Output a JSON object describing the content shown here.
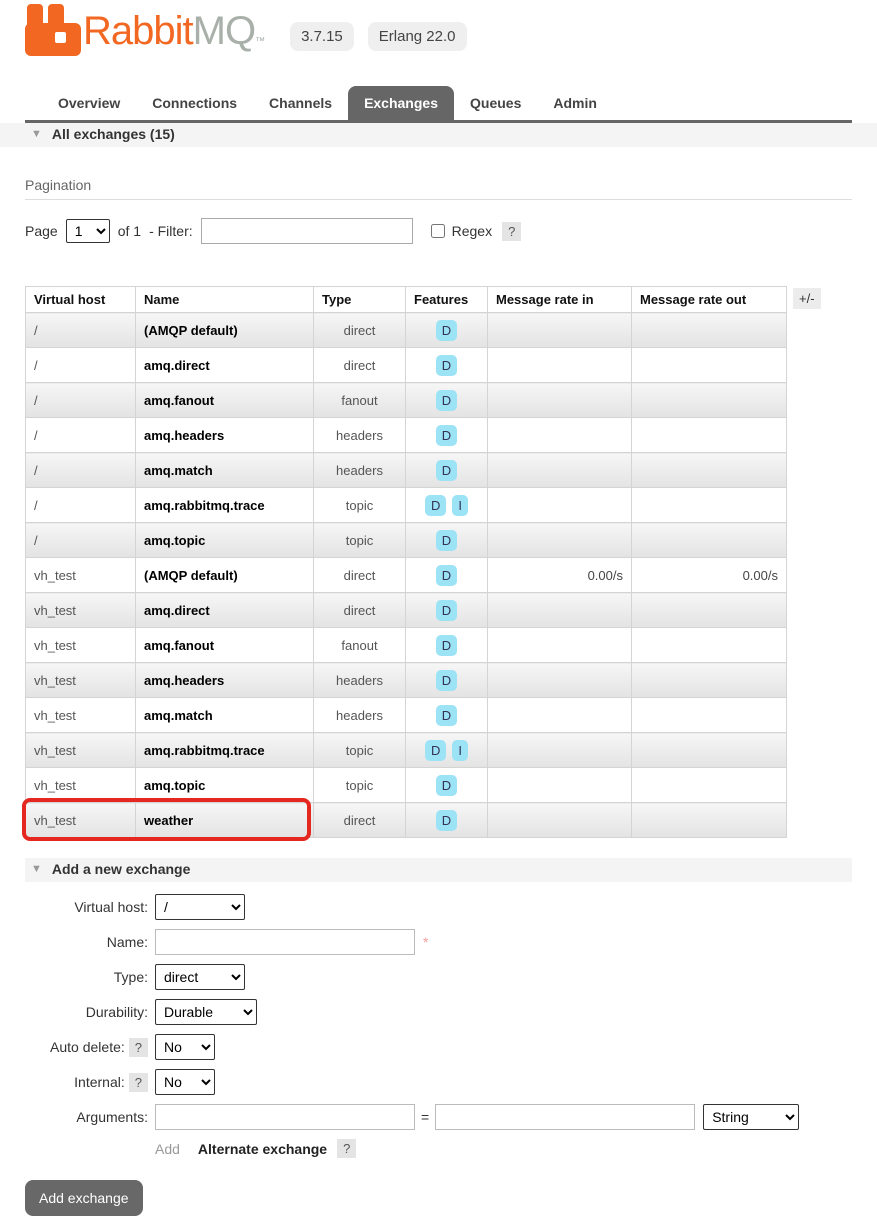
{
  "header": {
    "logo_rabbit": "Rabbit",
    "logo_mq": "MQ",
    "logo_tm": "™",
    "version_badge": "3.7.15",
    "erlang_badge": "Erlang 22.0"
  },
  "nav": {
    "tabs": [
      {
        "label": "Overview",
        "active": false
      },
      {
        "label": "Connections",
        "active": false
      },
      {
        "label": "Channels",
        "active": false
      },
      {
        "label": "Exchanges",
        "active": true
      },
      {
        "label": "Queues",
        "active": false
      },
      {
        "label": "Admin",
        "active": false
      }
    ]
  },
  "sections": {
    "all_exchanges_title": "All exchanges (15)",
    "add_exchange_title": "Add a new exchange"
  },
  "pagination": {
    "section_label": "Pagination",
    "page_label": "Page",
    "page_value": "1",
    "of_label": "of 1",
    "filter_label": "- Filter:",
    "filter_value": "",
    "regex_label": "Regex",
    "regex_checked": false,
    "regex_help": "?"
  },
  "table": {
    "headers": {
      "vhost": "Virtual host",
      "name": "Name",
      "type": "Type",
      "features": "Features",
      "rate_in": "Message rate in",
      "rate_out": "Message rate out"
    },
    "plus_minus": "+/-",
    "rows": [
      {
        "vhost": "/",
        "name": "(AMQP default)",
        "type": "direct",
        "features": [
          "D"
        ],
        "rate_in": "",
        "rate_out": ""
      },
      {
        "vhost": "/",
        "name": "amq.direct",
        "type": "direct",
        "features": [
          "D"
        ],
        "rate_in": "",
        "rate_out": ""
      },
      {
        "vhost": "/",
        "name": "amq.fanout",
        "type": "fanout",
        "features": [
          "D"
        ],
        "rate_in": "",
        "rate_out": ""
      },
      {
        "vhost": "/",
        "name": "amq.headers",
        "type": "headers",
        "features": [
          "D"
        ],
        "rate_in": "",
        "rate_out": ""
      },
      {
        "vhost": "/",
        "name": "amq.match",
        "type": "headers",
        "features": [
          "D"
        ],
        "rate_in": "",
        "rate_out": ""
      },
      {
        "vhost": "/",
        "name": "amq.rabbitmq.trace",
        "type": "topic",
        "features": [
          "D",
          "I"
        ],
        "rate_in": "",
        "rate_out": ""
      },
      {
        "vhost": "/",
        "name": "amq.topic",
        "type": "topic",
        "features": [
          "D"
        ],
        "rate_in": "",
        "rate_out": ""
      },
      {
        "vhost": "vh_test",
        "name": "(AMQP default)",
        "type": "direct",
        "features": [
          "D"
        ],
        "rate_in": "0.00/s",
        "rate_out": "0.00/s"
      },
      {
        "vhost": "vh_test",
        "name": "amq.direct",
        "type": "direct",
        "features": [
          "D"
        ],
        "rate_in": "",
        "rate_out": ""
      },
      {
        "vhost": "vh_test",
        "name": "amq.fanout",
        "type": "fanout",
        "features": [
          "D"
        ],
        "rate_in": "",
        "rate_out": ""
      },
      {
        "vhost": "vh_test",
        "name": "amq.headers",
        "type": "headers",
        "features": [
          "D"
        ],
        "rate_in": "",
        "rate_out": ""
      },
      {
        "vhost": "vh_test",
        "name": "amq.match",
        "type": "headers",
        "features": [
          "D"
        ],
        "rate_in": "",
        "rate_out": ""
      },
      {
        "vhost": "vh_test",
        "name": "amq.rabbitmq.trace",
        "type": "topic",
        "features": [
          "D",
          "I"
        ],
        "rate_in": "",
        "rate_out": ""
      },
      {
        "vhost": "vh_test",
        "name": "amq.topic",
        "type": "topic",
        "features": [
          "D"
        ],
        "rate_in": "",
        "rate_out": ""
      },
      {
        "vhost": "vh_test",
        "name": "weather",
        "type": "direct",
        "features": [
          "D"
        ],
        "rate_in": "",
        "rate_out": "",
        "highlighted": true
      }
    ],
    "annotation": {
      "description": "red highlight box around vhost and name cells of weather row",
      "color": "#e4281f"
    }
  },
  "form": {
    "virtual_host": {
      "label": "Virtual host:",
      "value": "/"
    },
    "name": {
      "label": "Name:",
      "value": "",
      "required_marker": "*"
    },
    "type": {
      "label": "Type:",
      "value": "direct"
    },
    "durability": {
      "label": "Durability:",
      "value": "Durable"
    },
    "auto_delete": {
      "label": "Auto delete:",
      "help": "?",
      "value": "No"
    },
    "internal": {
      "label": "Internal:",
      "help": "?",
      "value": "No"
    },
    "arguments": {
      "label": "Arguments:",
      "key_value": "",
      "equals": "=",
      "value_value": "",
      "type_value": "String"
    },
    "add_link": "Add",
    "alternate_exchange": {
      "label": "Alternate exchange",
      "help": "?"
    },
    "submit_label": "Add exchange"
  },
  "colors": {
    "brand_orange": "#f26822",
    "logo_gray": "#a8b0a9",
    "active_tab_bg": "#666666",
    "feature_badge_blue": "#9be3f5",
    "highlight_red": "#e4281f",
    "button_gray": "#686868"
  }
}
